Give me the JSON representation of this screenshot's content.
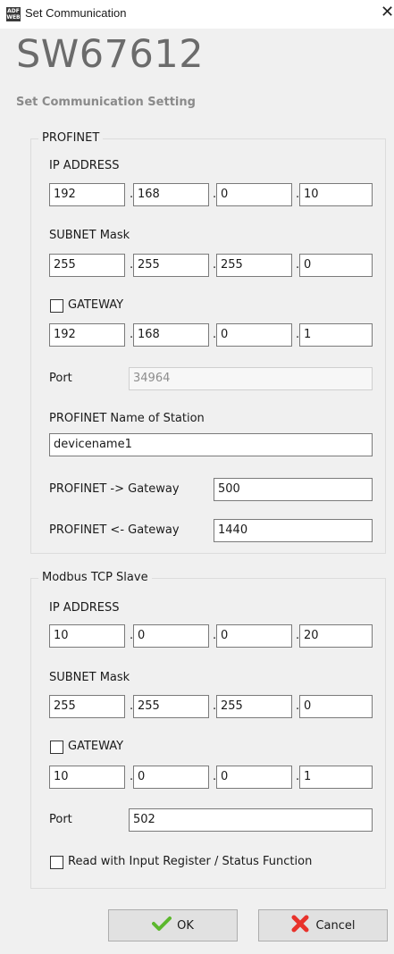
{
  "window": {
    "title": "Set Communication",
    "icon_text": "ADF WEB"
  },
  "header": {
    "product": "SW67612",
    "subtitle": "Set Communication Setting"
  },
  "profinet": {
    "group_title": "PROFINET",
    "ip_label": "IP ADDRESS",
    "ip": [
      "192",
      "168",
      "0",
      "10"
    ],
    "subnet_label": "SUBNET Mask",
    "subnet": [
      "255",
      "255",
      "255",
      "0"
    ],
    "gateway_label": "GATEWAY",
    "gateway_checked": false,
    "gateway": [
      "192",
      "168",
      "0",
      "1"
    ],
    "port_label": "Port",
    "port": "34964",
    "name_label": "PROFINET Name of Station",
    "name": "devicename1",
    "to_gw_label": "PROFINET -> Gateway",
    "to_gw": "500",
    "from_gw_label": "PROFINET <- Gateway",
    "from_gw": "1440"
  },
  "modbus": {
    "group_title": "Modbus TCP Slave",
    "ip_label": "IP ADDRESS",
    "ip": [
      "10",
      "0",
      "0",
      "20"
    ],
    "subnet_label": "SUBNET Mask",
    "subnet": [
      "255",
      "255",
      "255",
      "0"
    ],
    "gateway_label": "GATEWAY",
    "gateway_checked": false,
    "gateway": [
      "10",
      "0",
      "0",
      "1"
    ],
    "port_label": "Port",
    "port": "502",
    "read_input_label": "Read with Input Register / Status Function",
    "read_input_checked": false
  },
  "buttons": {
    "ok": "OK",
    "cancel": "Cancel"
  },
  "icons": {
    "ok": "checkmark-icon",
    "cancel": "red-x-icon"
  },
  "colors": {
    "ok_check": "#5cb82e",
    "cancel_x": "#e8322b"
  }
}
